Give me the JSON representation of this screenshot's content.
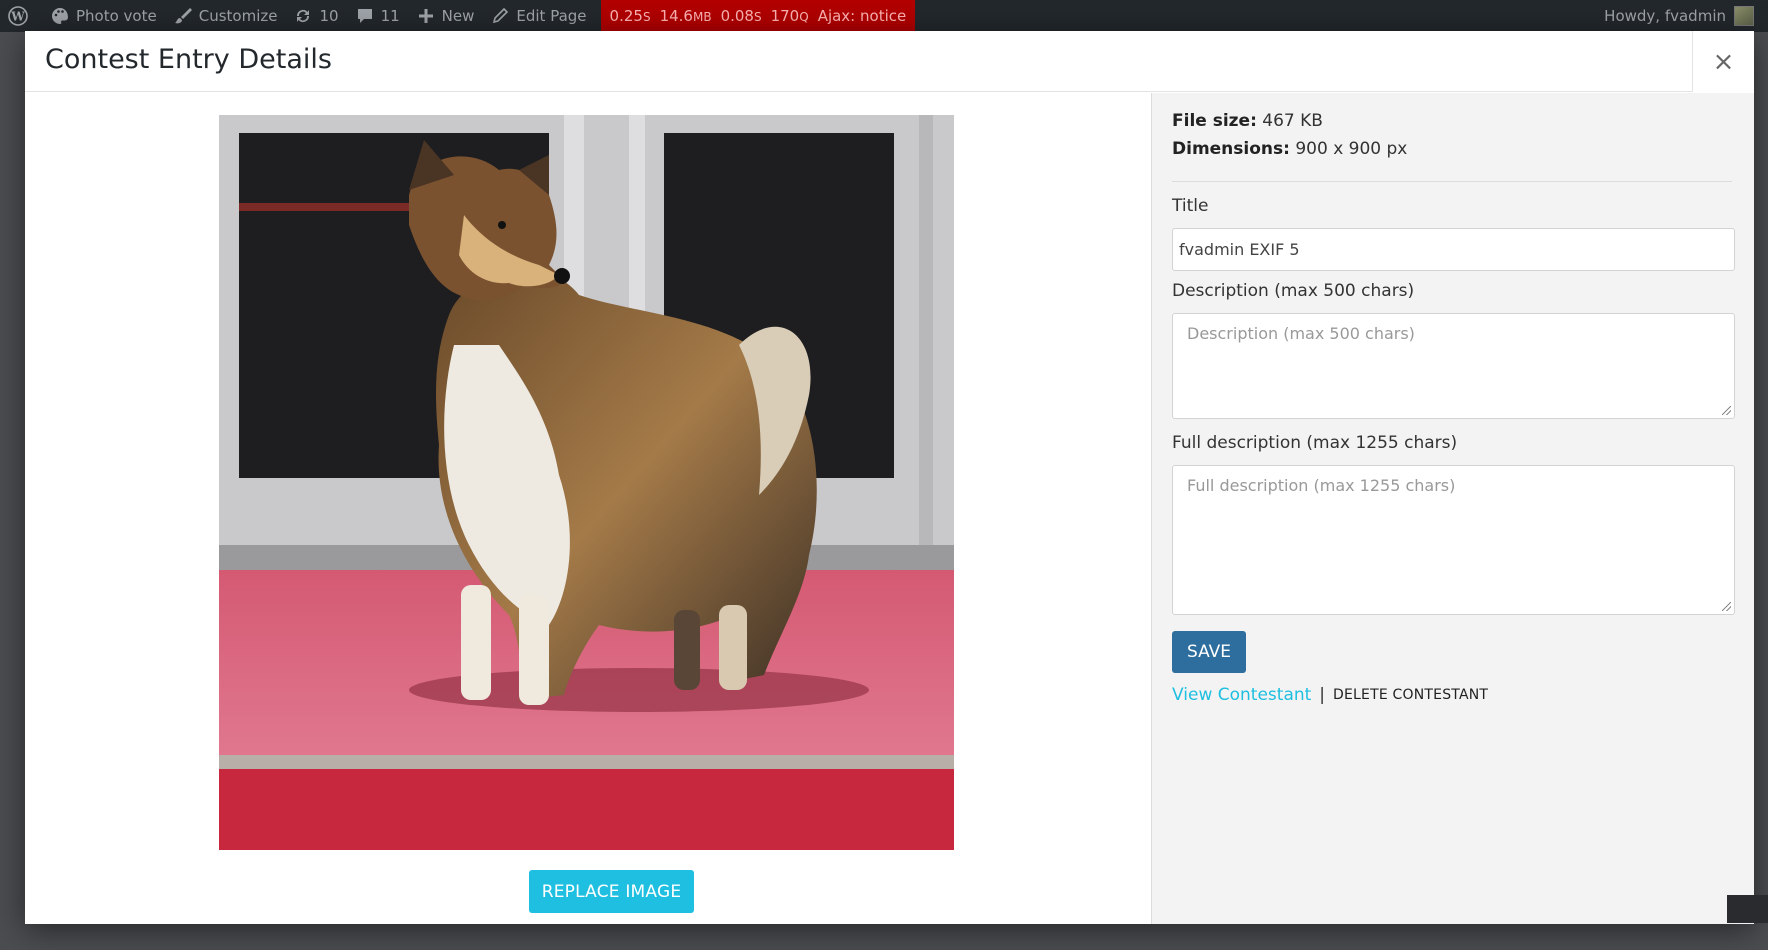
{
  "adminbar": {
    "site_name": "Photo vote",
    "customize": "Customize",
    "updates": "10",
    "comments": "11",
    "new": "New",
    "edit_page": "Edit Page",
    "debug": {
      "time": "0.25",
      "time_unit": "S",
      "memory": "14.6",
      "memory_unit": "MB",
      "query_time": "0.08",
      "query_time_unit": "S",
      "queries": "170",
      "queries_unit": "Q",
      "ajax": "Ajax: notice"
    },
    "howdy": "Howdy, fvadmin"
  },
  "modal": {
    "title": "Contest Entry Details",
    "close_glyph": "×",
    "replace_image_label": "REPLACE IMAGE",
    "file_size_label": "File size:",
    "file_size_value": "467 KB",
    "dimensions_label": "Dimensions:",
    "dimensions_value": "900 x 900 px",
    "title_label": "Title",
    "title_value": "fvadmin EXIF 5",
    "description_label": "Description (max 500 chars)",
    "description_placeholder": "Description (max 500 chars)",
    "full_description_label": "Full description (max 1255 chars)",
    "full_description_placeholder": "Full description (max 1255 chars)",
    "save_label": "SAVE",
    "view_contestant_label": "View Contestant",
    "separator": "|",
    "delete_contestant_label": "DELETE CONTESTANT"
  },
  "colors": {
    "adminbar_bg": "#23282d",
    "debug_bg": "#b20000",
    "replace_button": "#1ebfe0",
    "save_button": "#2e6e9e",
    "link": "#1ebfe0"
  },
  "icons": [
    "wordpress-icon",
    "palette-icon",
    "brush-icon",
    "refresh-icon",
    "comment-icon",
    "plus-icon",
    "pencil-icon",
    "close-icon",
    "resize-grip-icon"
  ]
}
